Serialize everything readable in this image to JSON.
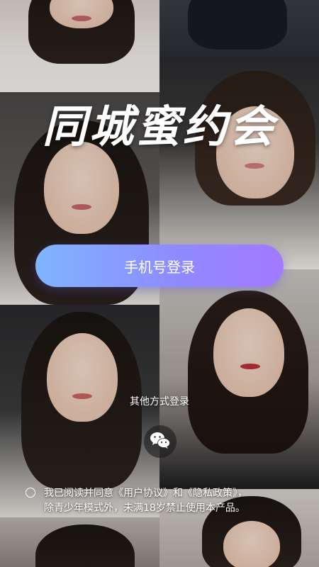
{
  "app": {
    "title": "同城蜜约会"
  },
  "login": {
    "phone_button_label": "手机号登录",
    "other_methods_label": "其他方式登录",
    "wechat_icon": "wechat-icon"
  },
  "agreement": {
    "prefix": "我已阅读并同意",
    "user_agreement": "《用户协议》",
    "and": "和",
    "privacy_policy": "《隐私政策》",
    "comma": "，",
    "notice": "除青少年模式外，未满18岁禁止使用本产品。"
  },
  "colors": {
    "button_gradient_start": "#7fb5ff",
    "button_gradient_end": "#a279ff",
    "text": "#ffffff"
  }
}
